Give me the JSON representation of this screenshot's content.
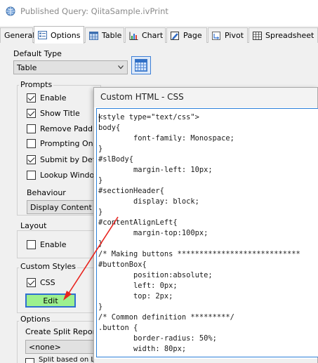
{
  "window": {
    "title": "Published Query: QiitaSample.ivPrint"
  },
  "tabs": [
    {
      "label": "General",
      "icon": "none-icon"
    },
    {
      "label": "Options",
      "icon": "options-icon"
    },
    {
      "label": "Table",
      "icon": "table-icon"
    },
    {
      "label": "Chart",
      "icon": "chart-icon"
    },
    {
      "label": "Page",
      "icon": "page-icon"
    },
    {
      "label": "Pivot",
      "icon": "pivot-icon"
    },
    {
      "label": "Spreadsheet",
      "icon": "spreadsheet-icon"
    }
  ],
  "options": {
    "default_type_label": "Default Type",
    "default_type_value": "Table",
    "prompts": {
      "title": "Prompts",
      "items": [
        {
          "label": "Enable",
          "checked": true
        },
        {
          "label": "Show Title",
          "checked": true
        },
        {
          "label": "Remove Padding",
          "checked": false
        },
        {
          "label": "Prompting Only",
          "checked": false
        },
        {
          "label": "Submit by Default",
          "checked": true
        },
        {
          "label": "Lookup Window",
          "checked": false
        }
      ],
      "behaviour_label": "Behaviour",
      "behaviour_value": "Display Content"
    },
    "layout": {
      "title": "Layout",
      "enable_label": "Enable",
      "enable_checked": false
    },
    "custom_styles": {
      "title": "Custom Styles",
      "css_label": "CSS",
      "css_checked": true,
      "edit_label": "Edit"
    },
    "options_group": {
      "title": "Options",
      "split_label": "Create Split Reports b",
      "split_value": "<none>",
      "split_based_label": "Split based on Le"
    }
  },
  "dialog": {
    "title": "Custom HTML - CSS",
    "code_lines": [
      "<style type=\"text/css\">",
      "body{",
      "        font-family: Monospace;",
      "}",
      "#slBody{",
      "        margin-left: 10px;",
      "}",
      "#sectionHeader{",
      "        display: block;",
      "}",
      "#contentAlignLeft{",
      "        margin-top:100px;",
      "}",
      "/* Making buttons ****************************",
      "#buttonBox{",
      "        position:absolute;",
      "        left: 0px;",
      "        top: 2px;",
      "}",
      "/* Common definition *********/",
      ".button {",
      "        border-radius: 50%;",
      "        width: 80px;"
    ]
  },
  "colors": {
    "edit_button_bg": "#9df08e",
    "edit_button_border": "#2f6fd0",
    "code_border": "#2b7fd9",
    "annotation_arrow": "#e8231e"
  }
}
